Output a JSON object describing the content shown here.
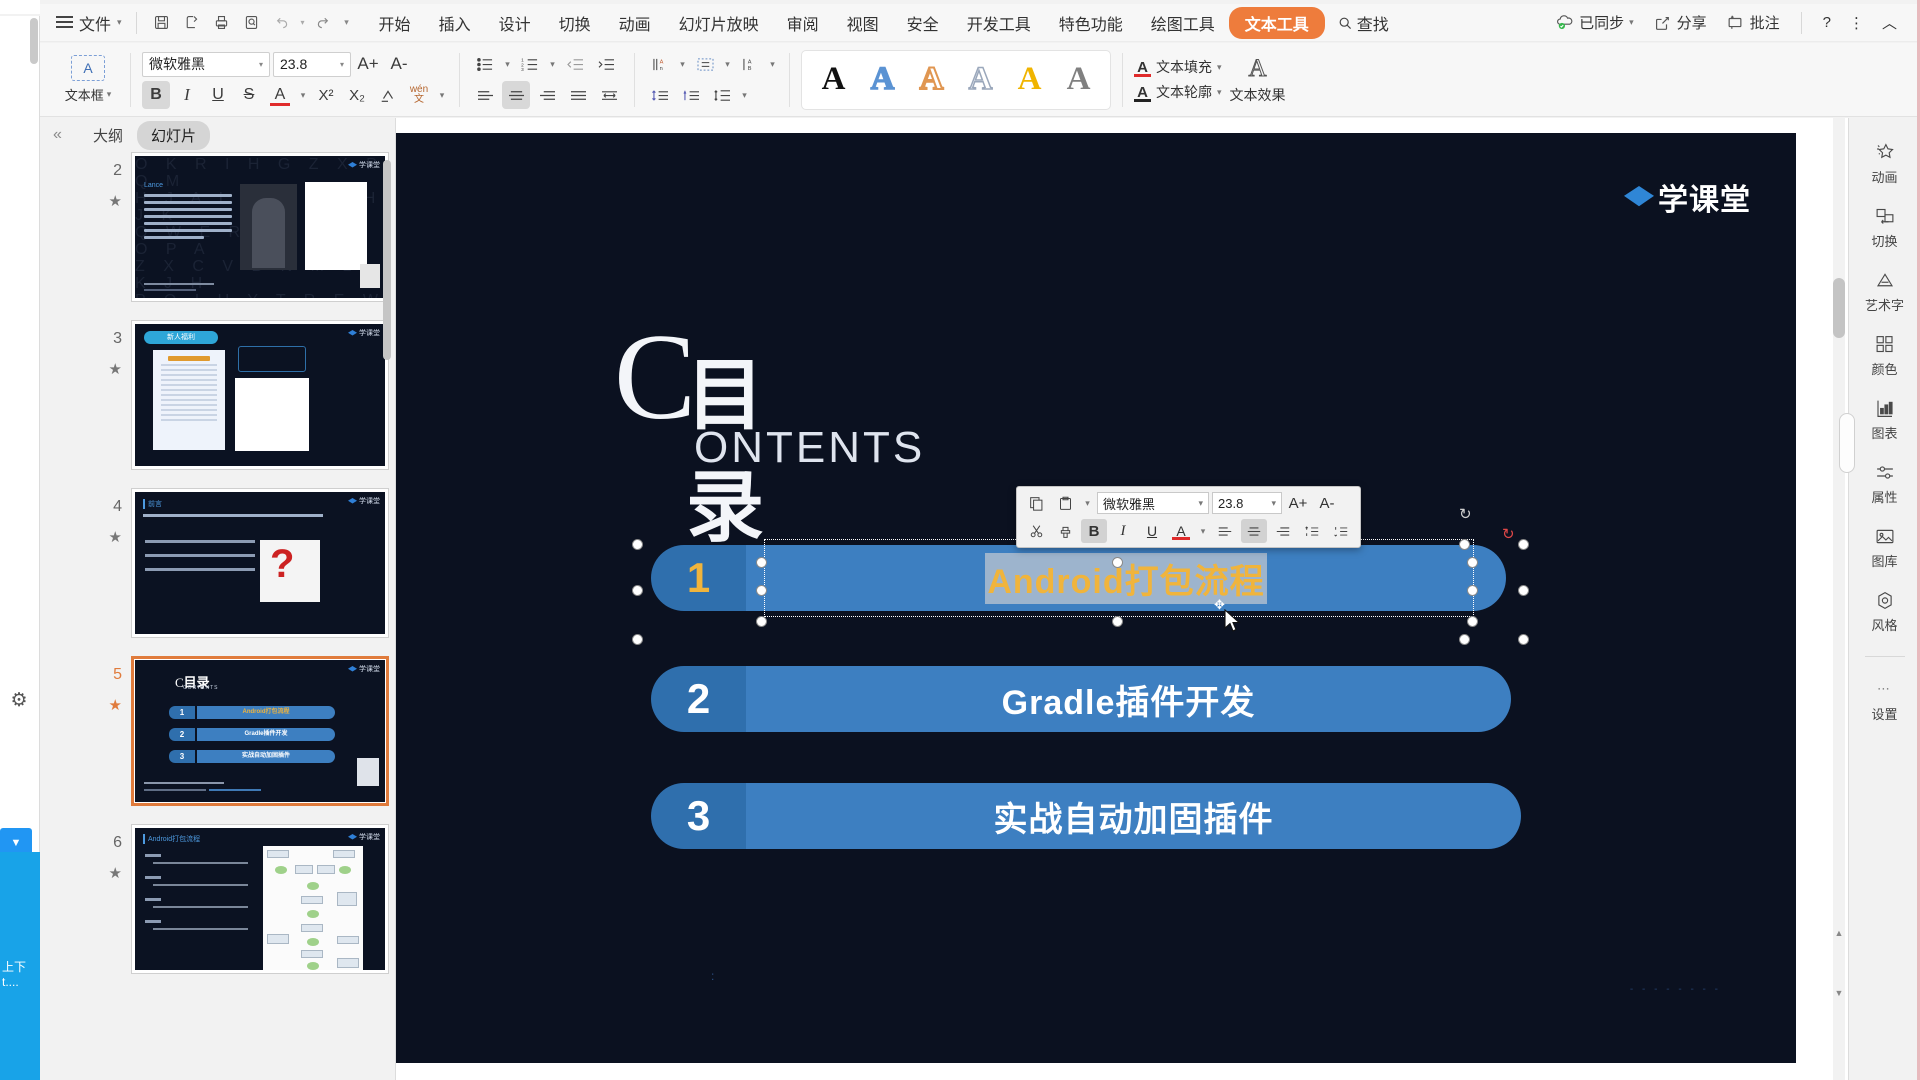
{
  "menubar": {
    "file_label": "文件",
    "quick_icons": [
      "save-icon",
      "print-preview-icon",
      "print-icon",
      "search-doc-icon",
      "undo-icon",
      "redo-icon",
      "customize-icon"
    ],
    "tabs": [
      {
        "label": "开始",
        "active": false
      },
      {
        "label": "插入",
        "active": false
      },
      {
        "label": "设计",
        "active": false
      },
      {
        "label": "切换",
        "active": false
      },
      {
        "label": "动画",
        "active": false
      },
      {
        "label": "幻灯片放映",
        "active": false
      },
      {
        "label": "审阅",
        "active": false
      },
      {
        "label": "视图",
        "active": false
      },
      {
        "label": "安全",
        "active": false
      },
      {
        "label": "开发工具",
        "active": false
      },
      {
        "label": "特色功能",
        "active": false
      },
      {
        "label": "绘图工具",
        "active": false
      },
      {
        "label": "文本工具",
        "active": true
      }
    ],
    "find_label": "查找",
    "right": [
      {
        "label": "已同步",
        "icon": "cloud-sync-icon"
      },
      {
        "label": "分享",
        "icon": "share-icon"
      },
      {
        "label": "批注",
        "icon": "comment-icon"
      }
    ],
    "help_label": "?",
    "more_label": "⋮",
    "collapse_label": "︿",
    "accent_color": "#ee7c3c"
  },
  "ribbon": {
    "textbox_label": "文本框",
    "font_name": "微软雅黑",
    "font_size": "23.8",
    "grow_font": "A+",
    "shrink_font": "A-",
    "bold": "B",
    "italic": "I",
    "underline": "U",
    "strikethrough": "S",
    "font_color": "A",
    "superscript": "X²",
    "subscript": "X₂",
    "clear_format": "clear-format-icon",
    "phonetic": "wén 文",
    "bullets_icon": "bullet-list-icon",
    "numbering_icon": "numbered-list-icon",
    "decrease_indent": "decrease-indent-icon",
    "increase_indent": "increase-indent-icon",
    "align_left": "align-left-icon",
    "align_center": "align-center-icon",
    "align_right": "align-right-icon",
    "align_justify": "align-justify-icon",
    "align_distribute": "align-distribute-icon",
    "line_spacing": "line-spacing-icon",
    "text_direction": "text-direction-icon",
    "align_text": "align-text-icon",
    "columns": "columns-icon",
    "para_space_before": "space-before-icon",
    "para_space_after": "space-after-icon",
    "para_line": "paragraph-spacing-icon",
    "wordart_styles": [
      {
        "name": "style-black",
        "glyph": "A",
        "color": "#111111"
      },
      {
        "name": "style-blue",
        "glyph": "A",
        "color": "#5b93d3"
      },
      {
        "name": "style-orange-outline",
        "glyph": "A",
        "color": "#e09651"
      },
      {
        "name": "style-gray-outline",
        "glyph": "A",
        "color": "#9aa7bb"
      },
      {
        "name": "style-yellow",
        "glyph": "A",
        "color": "#f0b400"
      },
      {
        "name": "style-gray",
        "glyph": "A",
        "color": "#808080"
      }
    ],
    "text_fill_label": "文本填充",
    "text_outline_label": "文本轮廓",
    "text_effects_label": "文本效果"
  },
  "thumbpane": {
    "collapse_icon": "collapse-left-icon",
    "tabs": [
      {
        "label": "大纲",
        "active": false
      },
      {
        "label": "幻灯片",
        "active": true
      }
    ],
    "slides": [
      {
        "number": "2",
        "starred": true,
        "selected": false,
        "name": "lance-profile-slide"
      },
      {
        "number": "3",
        "starred": true,
        "selected": false,
        "name": "newcomer-benefit-slide",
        "badge": "新人福利",
        "doc_title": "免费领取"
      },
      {
        "number": "4",
        "starred": true,
        "selected": false,
        "name": "question-slide",
        "title": "前言"
      },
      {
        "number": "5",
        "starred": true,
        "selected": true,
        "name": "contents-slide",
        "title": "目录",
        "subtitle": "CONTENTS",
        "items": [
          {
            "num": "1",
            "text": "Android打包流程"
          },
          {
            "num": "2",
            "text": "Gradle插件开发"
          },
          {
            "num": "3",
            "text": "实战自动加固插件"
          }
        ]
      },
      {
        "number": "6",
        "starred": true,
        "selected": false,
        "name": "android-build-flow-slide",
        "title": "Android打包流程"
      }
    ]
  },
  "slide": {
    "logo_text": "学课堂",
    "heading_letter": "C",
    "heading_cn": "目 录",
    "heading_en": "ONTENTS",
    "items": [
      {
        "num": "1",
        "text": "Android打包流程",
        "selected": true,
        "text_color": "#f0b43c"
      },
      {
        "num": "2",
        "text": "Gradle插件开发",
        "selected": false,
        "text_color": "#ffffff"
      },
      {
        "num": "3",
        "text": "实战自动加固插件",
        "selected": false,
        "text_color": "#ffffff"
      }
    ],
    "bar_color": "#3d7fc1",
    "num_color": "#2f6fad",
    "background": "#0b1120"
  },
  "minitoolbar": {
    "copy_icon": "copy-icon",
    "paste_icon": "paste-icon",
    "font_name": "微软雅黑",
    "font_size": "23.8",
    "grow": "A+",
    "shrink": "A-",
    "cut_icon": "cut-icon",
    "format_painter_icon": "format-painter-icon",
    "bold": "B",
    "italic": "I",
    "underline": "U",
    "font_color": "A",
    "align_left": "align-left-icon",
    "align_center": "align-center-icon",
    "align_right": "align-right-icon",
    "list_up": "increase-list-icon",
    "list_down": "decrease-list-icon"
  },
  "rsidebar": {
    "items": [
      {
        "label": "动画",
        "icon": "animation-icon"
      },
      {
        "label": "切换",
        "icon": "transition-icon"
      },
      {
        "label": "艺术字",
        "icon": "wordart-icon"
      },
      {
        "label": "颜色",
        "icon": "color-icon"
      },
      {
        "label": "图表",
        "icon": "chart-icon"
      },
      {
        "label": "属性",
        "icon": "properties-icon"
      },
      {
        "label": "图库",
        "icon": "gallery-icon"
      },
      {
        "label": "风格",
        "icon": "style-icon"
      }
    ],
    "settings_label": "设置",
    "settings_icon": "settings-dots-icon"
  },
  "leftstrip": {
    "gear_icon": "gear-icon",
    "dropdown_icon": "chevron-down-icon",
    "blue_text": "上下 t...."
  }
}
